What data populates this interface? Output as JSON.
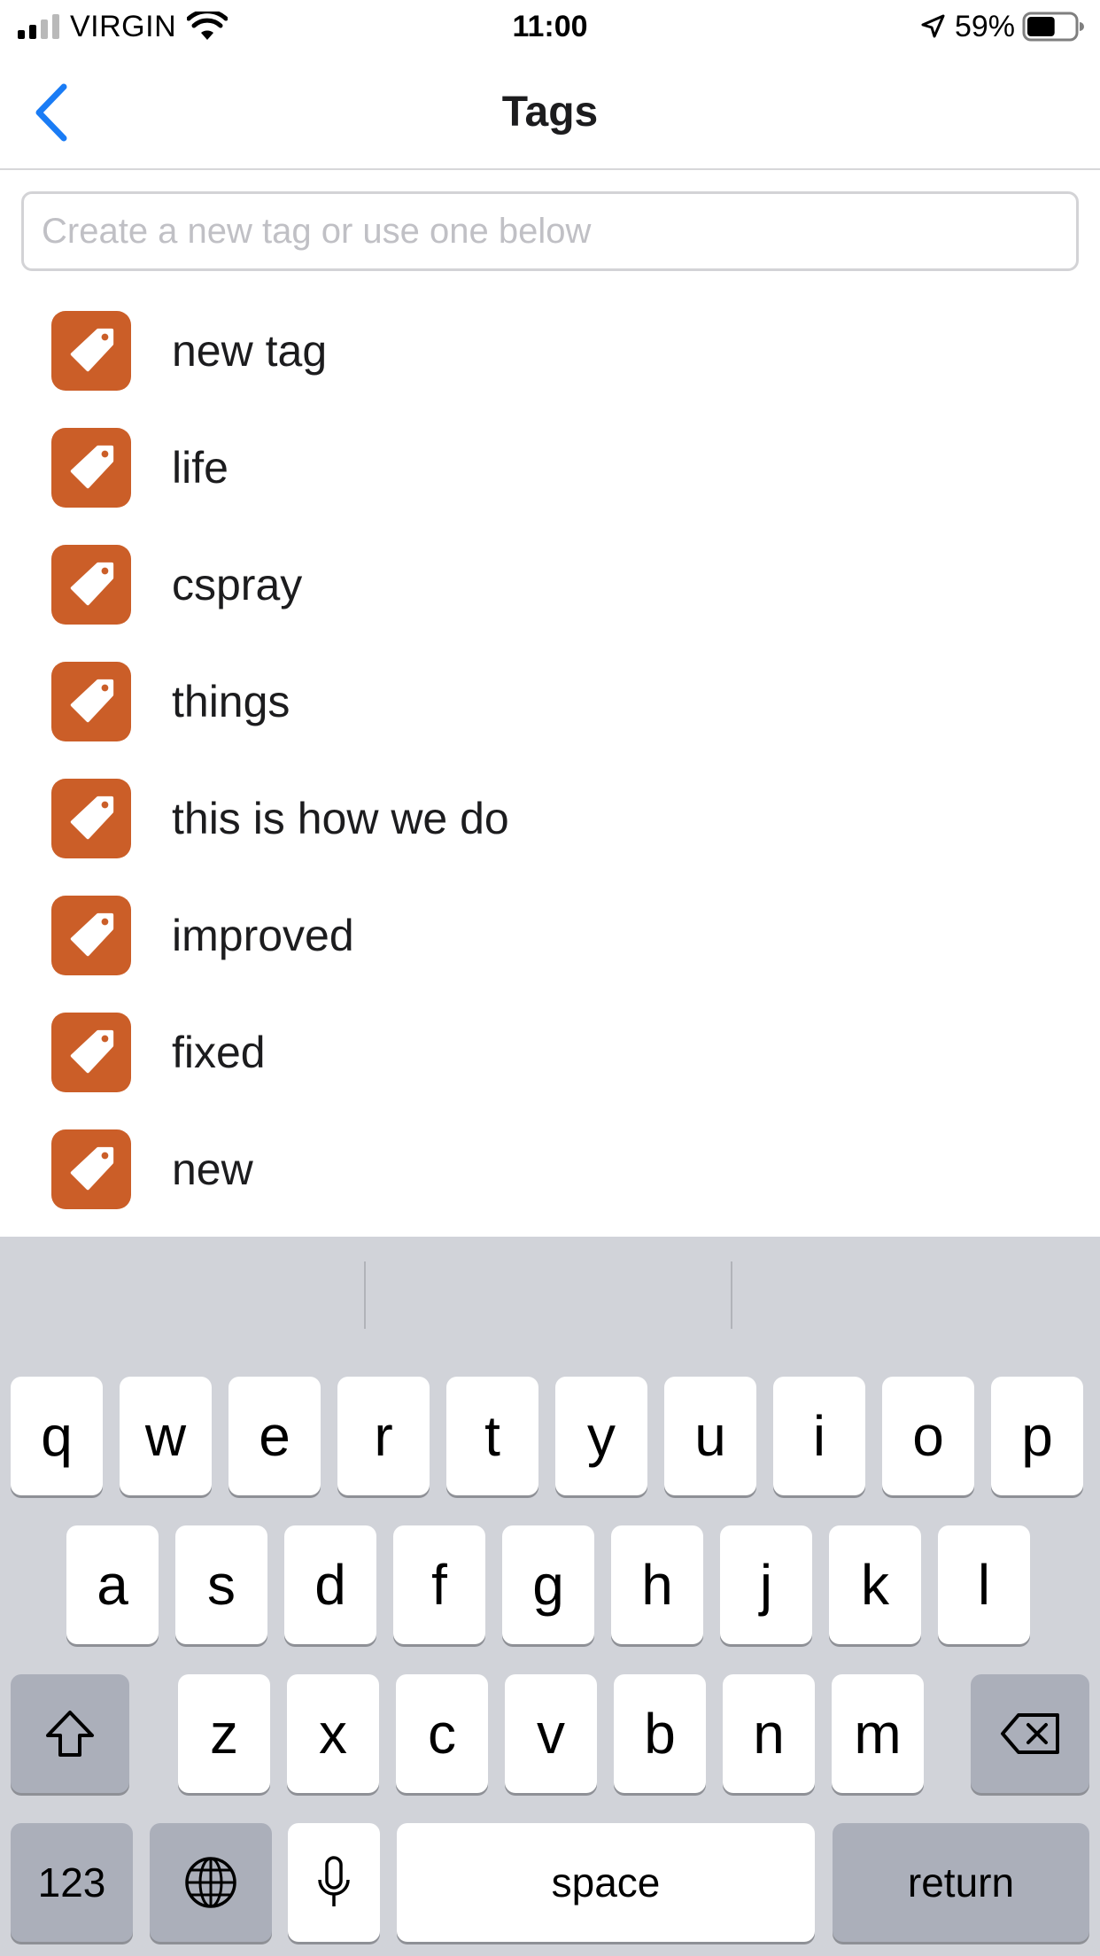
{
  "status_bar": {
    "carrier": "VIRGIN",
    "time": "11:00",
    "battery_percent": "59%",
    "signal_bars_active": 2,
    "signal_bars_total": 4,
    "battery_level": 0.59
  },
  "nav": {
    "title": "Tags",
    "back_icon": "chevron-left-icon",
    "accent_color": "#1a7cf5"
  },
  "tag_input": {
    "placeholder": "Create a new tag or use one below",
    "value": ""
  },
  "tags": {
    "icon": "tag-icon",
    "icon_color": "#cb5e28",
    "items": [
      {
        "label": "new tag"
      },
      {
        "label": "life"
      },
      {
        "label": "cspray"
      },
      {
        "label": "things"
      },
      {
        "label": "this is how we do"
      },
      {
        "label": "improved"
      },
      {
        "label": "fixed"
      },
      {
        "label": "new"
      }
    ]
  },
  "keyboard": {
    "row1": [
      "q",
      "w",
      "e",
      "r",
      "t",
      "y",
      "u",
      "i",
      "o",
      "p"
    ],
    "row2": [
      "a",
      "s",
      "d",
      "f",
      "g",
      "h",
      "j",
      "k",
      "l"
    ],
    "row3": [
      "z",
      "x",
      "c",
      "v",
      "b",
      "n",
      "m"
    ],
    "shift_icon": "shift-icon",
    "delete_icon": "backspace-icon",
    "numbers_label": "123",
    "globe_icon": "globe-icon",
    "mic_icon": "microphone-icon",
    "space_label": "space",
    "return_label": "return"
  }
}
